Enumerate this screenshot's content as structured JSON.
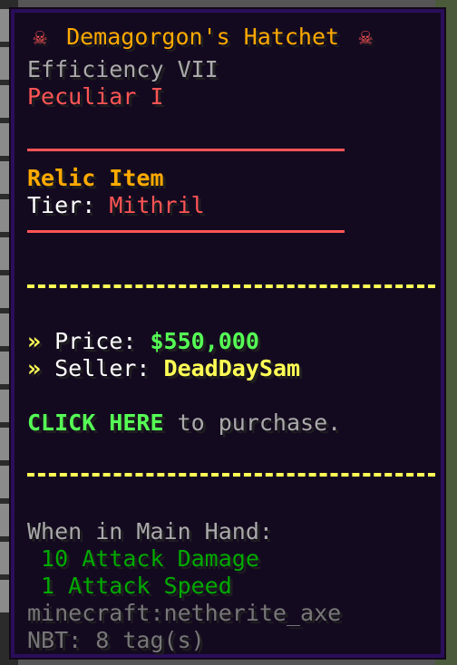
{
  "tooltip": {
    "title": "Demagorgon's Hatchet",
    "enchant_1": "Efficiency VII",
    "enchant_2": "Peculiar I",
    "rarity": "Relic Item",
    "tier_label": "Tier: ",
    "tier_value": "Mithril",
    "price_arrow": "»",
    "price_label": " Price: ",
    "price_value": "$550,000",
    "seller_arrow": "»",
    "seller_label": " Seller: ",
    "seller_value": "DeadDaySam",
    "click_here": "CLICK HERE",
    "click_rest": " to purchase.",
    "main_hand_header": "When in Main Hand:",
    "attack_damage": " 10 Attack Damage",
    "attack_speed": " 1 Attack Speed",
    "item_id": "minecraft:netherite_axe",
    "nbt": "NBT: 8 tag(s)"
  },
  "colors": {
    "title": "#ffaa00",
    "red": "#ff5555",
    "gold": "#ffaa00",
    "green": "#55ff55",
    "yellow": "#ffff55",
    "dark_green": "#00aa00",
    "gray": "#aaaaaa",
    "dark_gray": "#777777",
    "border": "#2a0e5a",
    "background": "#140a20"
  }
}
